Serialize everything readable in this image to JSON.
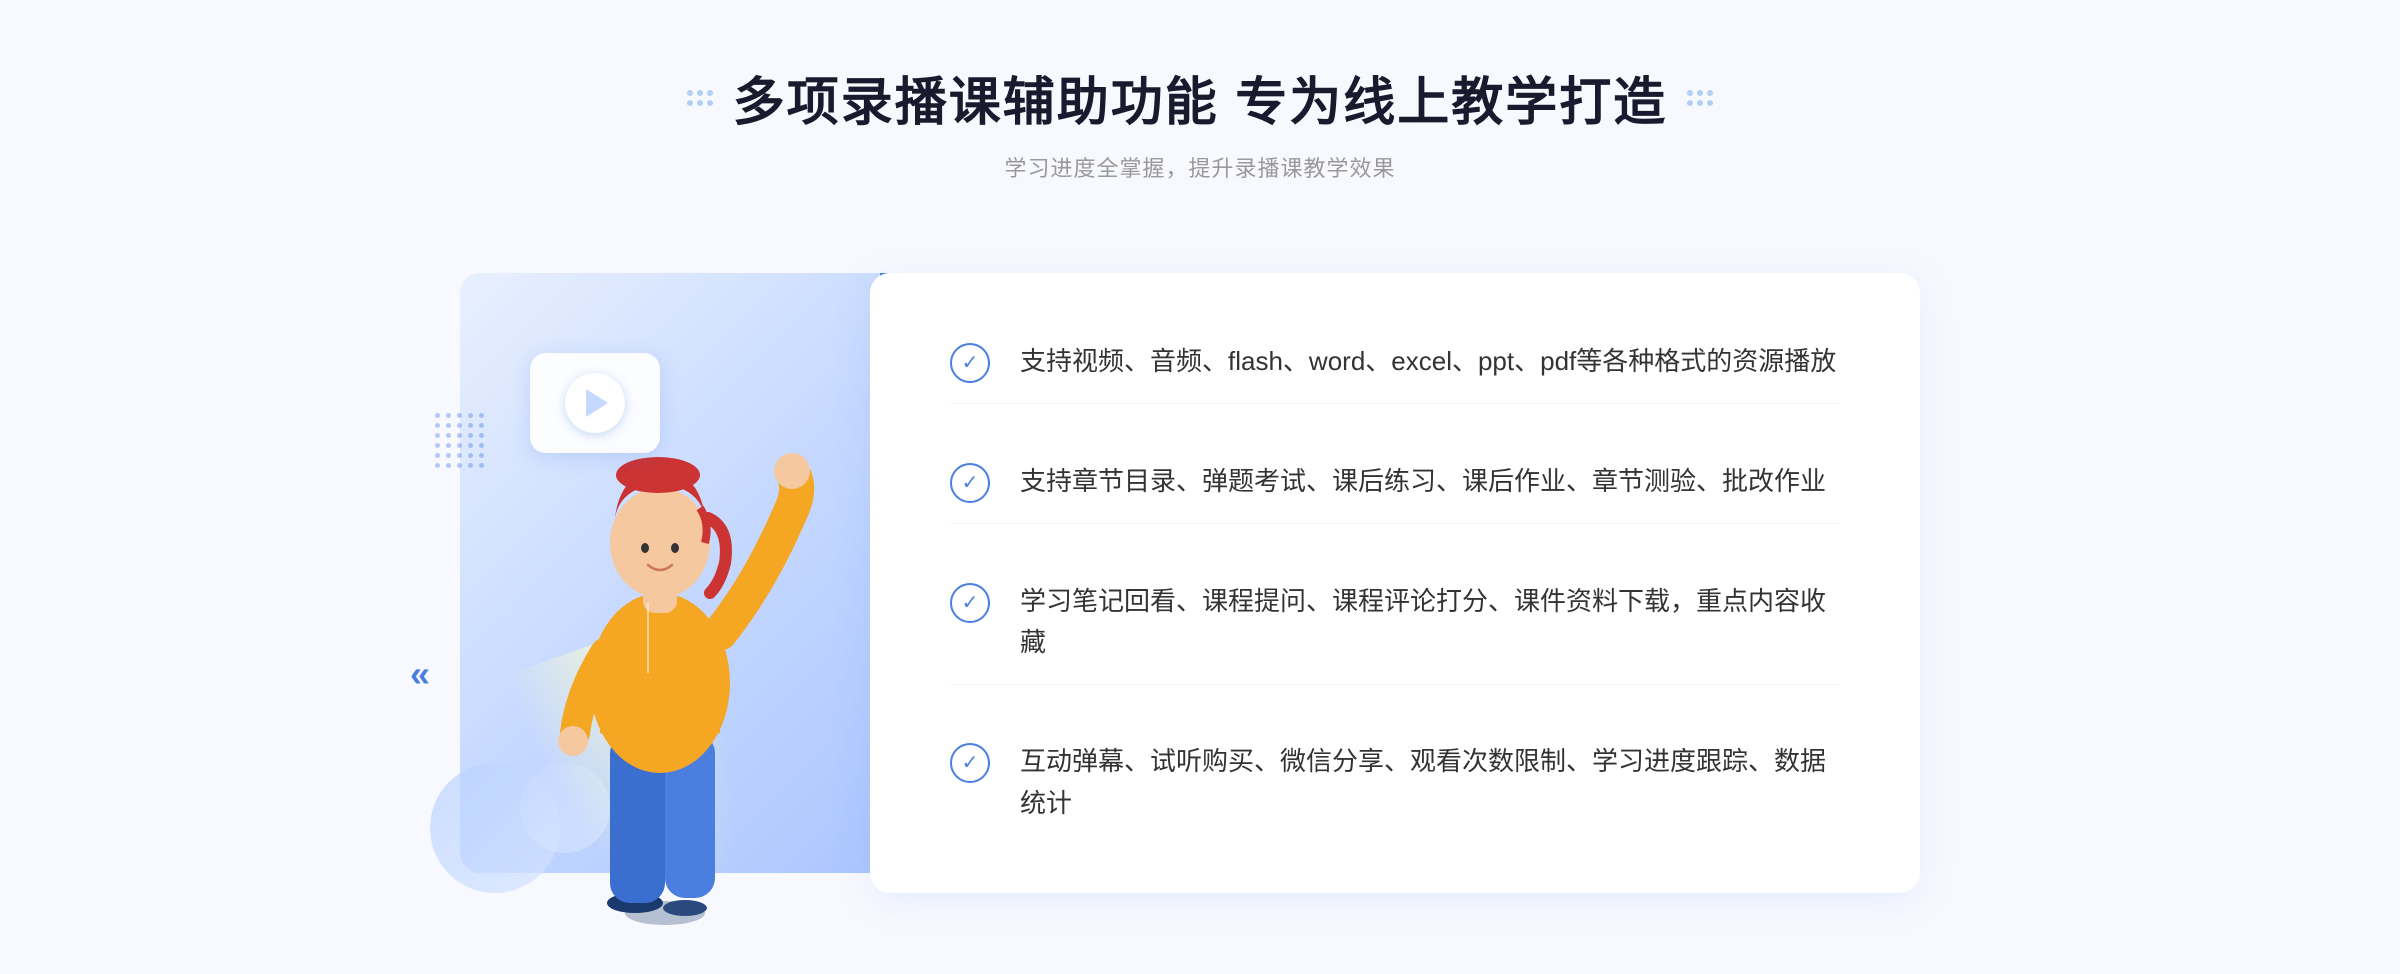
{
  "page": {
    "background": "#f5f7ff"
  },
  "header": {
    "title": "多项录播课辅助功能 专为线上教学打造",
    "subtitle": "学习进度全掌握，提升录播课教学效果",
    "title_dots_left": "decorative",
    "title_dots_right": "decorative"
  },
  "features": [
    {
      "id": 1,
      "text": "支持视频、音频、flash、word、excel、ppt、pdf等各种格式的资源播放"
    },
    {
      "id": 2,
      "text": "支持章节目录、弹题考试、课后练习、课后作业、章节测验、批改作业"
    },
    {
      "id": 3,
      "text": "学习笔记回看、课程提问、课程评论打分、课件资料下载，重点内容收藏"
    },
    {
      "id": 4,
      "text": "互动弹幕、试听购买、微信分享、观看次数限制、学习进度跟踪、数据统计"
    }
  ],
  "colors": {
    "primary_blue": "#4a7fdf",
    "light_blue": "#a8c4ff",
    "bg_blue": "#e8f0fe",
    "text_dark": "#333333",
    "text_gray": "#999999",
    "white": "#ffffff"
  },
  "icons": {
    "check": "✓",
    "chevron_left": "«",
    "play": "▶"
  }
}
